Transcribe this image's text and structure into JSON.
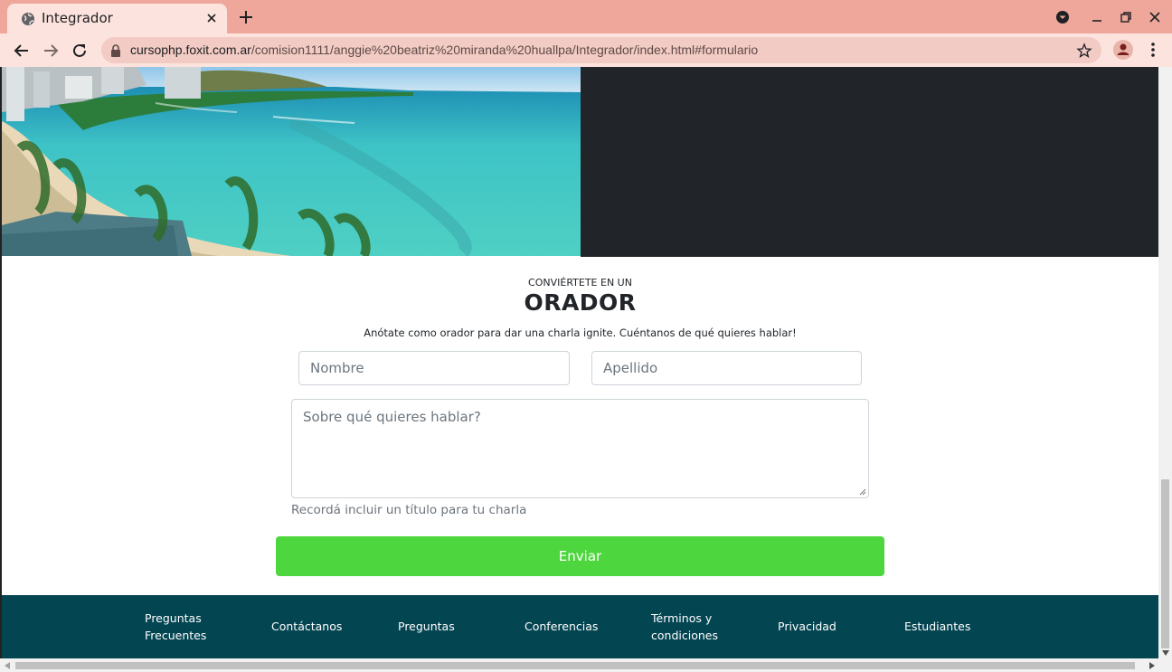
{
  "browser": {
    "tab_title": "Integrador",
    "url_host": "cursophp.foxit.com.ar",
    "url_path": "/comision1111/anggie%20beatriz%20miranda%20huallpa/Integrador/index.html#formulario"
  },
  "form_section": {
    "kicker": "CONVIÉRTETE EN UN",
    "heading": "ORADOR",
    "lead": "Anótate como orador para dar una charla ignite. Cuéntanos de qué quieres hablar!",
    "first_name_placeholder": "Nombre",
    "last_name_placeholder": "Apellido",
    "topic_placeholder": "Sobre qué quieres hablar?",
    "help_text": "Recordá incluir un título para tu charla",
    "submit_label": "Enviar"
  },
  "footer": {
    "links": [
      {
        "line1": "Preguntas",
        "line2": "Frecuentes"
      },
      {
        "line1": "Contáctanos",
        "line2": ""
      },
      {
        "line1": "Preguntas",
        "line2": ""
      },
      {
        "line1": "Conferencias",
        "line2": ""
      },
      {
        "line1": "Términos y",
        "line2": "condiciones"
      },
      {
        "line1": "Privacidad",
        "line2": ""
      },
      {
        "line1": "Estudiantes",
        "line2": ""
      }
    ]
  },
  "colors": {
    "tabbar": "#eea79a",
    "toolbar": "#fde3dd",
    "dark_panel": "#212529",
    "submit": "#4dd63d",
    "footer": "#044552"
  }
}
